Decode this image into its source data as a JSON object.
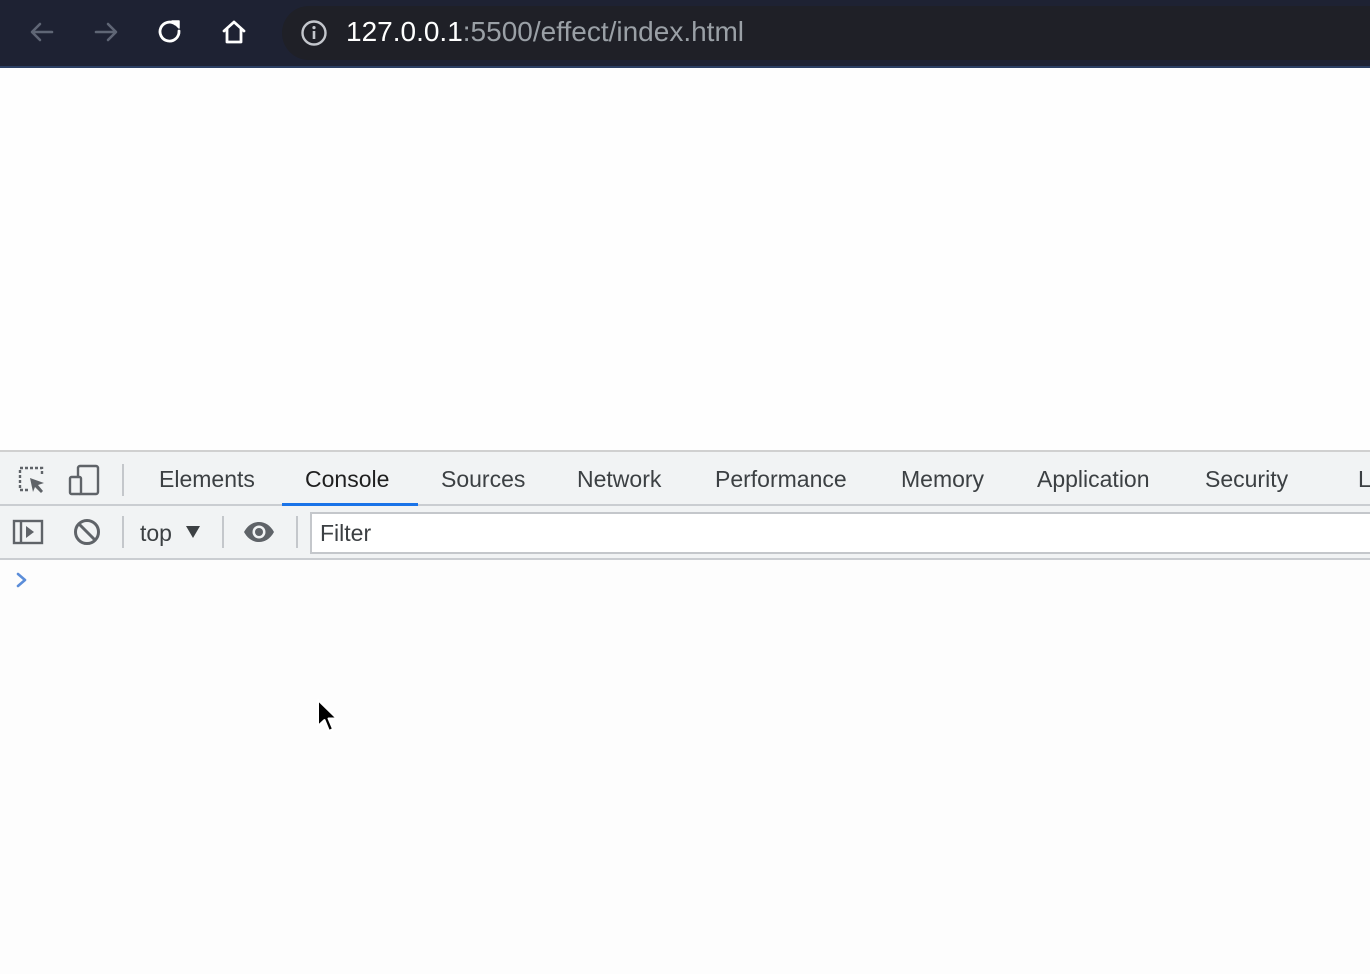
{
  "browser": {
    "url_host": "127.0.0.1",
    "url_rest": ":5500/effect/index.html",
    "icons": [
      "back-arrow-icon",
      "forward-arrow-icon",
      "reload-icon",
      "home-icon",
      "info-icon"
    ]
  },
  "devtools": {
    "tabs": [
      {
        "label": "Elements",
        "active": false
      },
      {
        "label": "Console",
        "active": true
      },
      {
        "label": "Sources",
        "active": false
      },
      {
        "label": "Network",
        "active": false
      },
      {
        "label": "Performance",
        "active": false
      },
      {
        "label": "Memory",
        "active": false
      },
      {
        "label": "Application",
        "active": false
      },
      {
        "label": "Security",
        "active": false
      },
      {
        "label": "L",
        "active": false
      }
    ],
    "console_toolbar": {
      "context": "top",
      "filter_placeholder": "Filter"
    },
    "colors": {
      "accent": "#1a73e8",
      "browser_bar": "#1e2233",
      "prompt_chevron": "#5b8dd9"
    }
  }
}
